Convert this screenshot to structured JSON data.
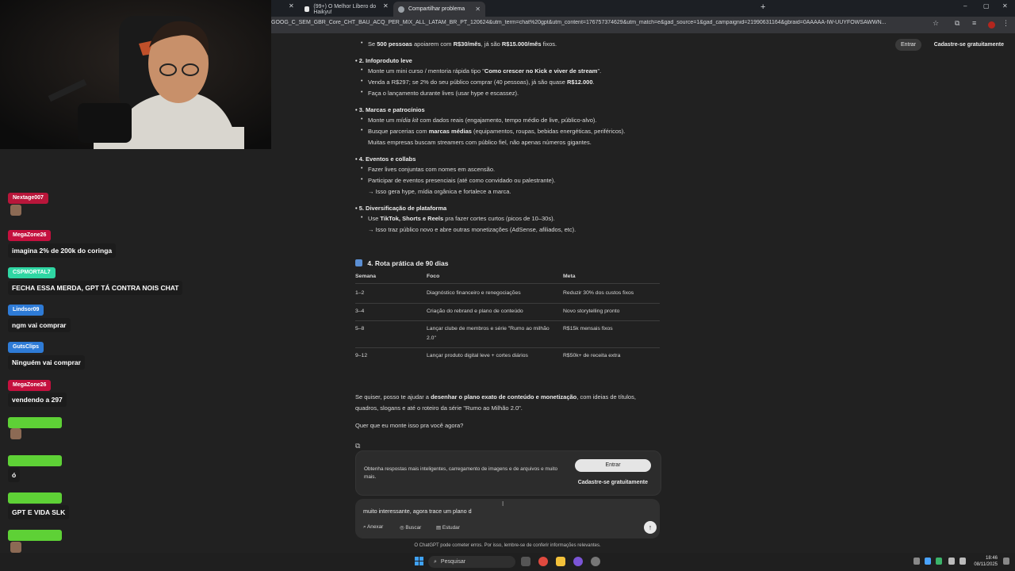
{
  "browser": {
    "tabs": [
      {
        "label": "(99+) O Melhor Líbero do Haikyu!"
      },
      {
        "label": "Compartilhar problema"
      }
    ],
    "url": "GOOG_C_SEM_GBR_Core_CHT_BAU_ACQ_PER_MIX_ALL_LATAM_BR_PT_120624&utm_term=chat%20gpt&utm_content=176757374629&utm_match=e&gad_source=1&gad_campaignid=21990631164&gbraid=0AAAAA-IW-UUYFOWSAWWN..."
  },
  "header": {
    "entrar": "Entrar",
    "cadastro": "Cadastre-se gratuitamente"
  },
  "content": {
    "lines": [
      {
        "type": "bullet",
        "parts": [
          "Se ",
          {
            "b": "500 pessoas"
          },
          " apoiarem com ",
          {
            "b": "R$30/mês"
          },
          ", já são ",
          {
            "b": "R$15.000/mês"
          },
          " fixos."
        ]
      },
      {
        "type": "heading",
        "text": "2. Infoproduto leve"
      },
      {
        "type": "bullet",
        "parts": [
          "Monte um mini curso / mentoria rápida tipo \"",
          {
            "b": "Como crescer no Kick e viver de stream"
          },
          "\"."
        ]
      },
      {
        "type": "bullet",
        "parts": [
          "Venda a R$297; se 2% do seu público comprar (40 pessoas), já são quase ",
          {
            "b": "R$12.000"
          },
          "."
        ]
      },
      {
        "type": "bullet",
        "parts": [
          "Faça o lançamento durante lives (usar hype e escassez)."
        ]
      },
      {
        "type": "heading",
        "text": "3. Marcas e patrocínios"
      },
      {
        "type": "bullet",
        "parts": [
          "Monte um ",
          {
            "i": "mídia kit"
          },
          " com dados reais (engajamento, tempo médio de live, público-alvo)."
        ]
      },
      {
        "type": "bullet",
        "parts": [
          "Busque parcerias com ",
          {
            "b": "marcas médias"
          },
          " (equipamentos, roupas, bebidas energéticas, periféricos)."
        ]
      },
      {
        "type": "cont",
        "parts": [
          "Muitas empresas buscam streamers com público fiel, não apenas números gigantes."
        ]
      },
      {
        "type": "heading",
        "text": "4. Eventos e collabs"
      },
      {
        "type": "bullet",
        "parts": [
          "Fazer lives conjuntas com nomes em ascensão."
        ]
      },
      {
        "type": "bullet",
        "parts": [
          "Participar de eventos presenciais (até como convidado ou palestrante)."
        ]
      },
      {
        "type": "cont",
        "parts": [
          "→ Isso gera hype, mídia orgânica e fortalece a marca."
        ]
      },
      {
        "type": "heading",
        "text": "5. Diversificação de plataforma"
      },
      {
        "type": "bullet",
        "parts": [
          "Use ",
          {
            "b": "TikTok, Shorts e Reels"
          },
          " pra fazer cortes curtos (picos de 10–30s)."
        ]
      },
      {
        "type": "cont",
        "parts": [
          "→ Isso traz público novo e abre outras monetizações (AdSense, afiliados, etc)."
        ]
      }
    ],
    "section_title": "4. Rota prática de 90 dias",
    "table": {
      "headers": [
        "Semana",
        "Foco",
        "Meta"
      ],
      "rows": [
        [
          "1–2",
          "Diagnóstico financeiro e renegociações",
          "Reduzir 30% dos custos fixos"
        ],
        [
          "3–4",
          "Criação do rebrand e plano de conteúdo",
          "Novo storytelling pronto"
        ],
        [
          "5–8",
          "Lançar clube de membros e série \"Rumo ao milhão 2.0\"",
          "R$15k mensais fixos"
        ],
        [
          "9–12",
          "Lançar produto digital leve + cortes diários",
          "R$50k+ de receita extra"
        ]
      ]
    },
    "closing_1_pre": "Se quiser, posso te ajudar a ",
    "closing_1_bold": "desenhar o plano exato de conteúdo e monetização",
    "closing_1_post": ", com ideias de títulos,",
    "closing_1b": "quadros, slogans e até o roteiro da série \"Rumo ao Milhão 2.0\".",
    "closing_2": "Quer que eu monte isso pra você agora?"
  },
  "promo": {
    "text": "Obtenha respostas mais inteligentes, carregamento de imagens e de arquivos e muito mais.",
    "entrar": "Entrar",
    "cadastro": "Cadastre-se gratuitamente"
  },
  "composer": {
    "value": "muito interessante, agora trace um plano d",
    "tools": [
      "Anexar",
      "Buscar",
      "Estudar"
    ]
  },
  "disclaimer": "O ChatGPT pode cometer erros. Por isso, lembre-se de conferir informações relevantes.",
  "chat": [
    {
      "user": "Nextage007",
      "color": "#b8163a",
      "emote": true
    },
    {
      "user": "MegaZone26",
      "color": "#c4103e",
      "msg": "imagina 2% de 200k do coringa"
    },
    {
      "user": "CSPMORTAL7",
      "color": "#2fd6a3",
      "msg": "FECHA ESSA MERDA, GPT TÁ CONTRA NOIS CHAT"
    },
    {
      "user": "Lindsor09",
      "color": "#2e7bd6",
      "msg": "ngm vai comprar"
    },
    {
      "user": "GutsClips",
      "color": "#2e7bd6",
      "msg": "Ninguém vai comprar"
    },
    {
      "user": "MegaZone26",
      "color": "#c4103e",
      "msg": "vendendo a 297"
    },
    {
      "user": "",
      "color": "#5ed136",
      "emote": true
    },
    {
      "user": "",
      "color": "#5ed136",
      "msg": "ó"
    },
    {
      "user": "",
      "color": "#5ed136",
      "msg": "GPT E VIDA SLK"
    },
    {
      "user": "",
      "color": "#5ed136",
      "emote": true
    }
  ],
  "taskbar": {
    "search": "Pesquisar",
    "time": "18:46",
    "date": "08/11/2025"
  }
}
